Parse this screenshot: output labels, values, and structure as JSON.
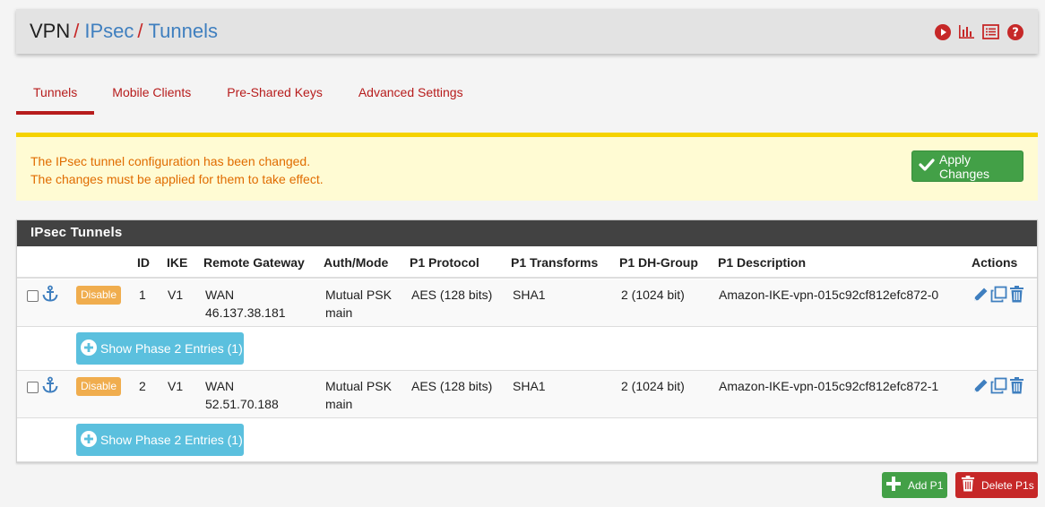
{
  "breadcrumb": {
    "part1": "VPN",
    "sep1": "/",
    "part2": "IPsec",
    "sep2": "/",
    "part3": "Tunnels"
  },
  "header_icons": [
    "play-circle-icon",
    "bar-chart-icon",
    "list-icon",
    "question-circle-icon"
  ],
  "tabs": [
    {
      "label": "Tunnels",
      "active": true
    },
    {
      "label": "Mobile Clients",
      "active": false
    },
    {
      "label": "Pre-Shared Keys",
      "active": false
    },
    {
      "label": "Advanced Settings",
      "active": false
    }
  ],
  "alert": {
    "line1": "The IPsec tunnel configuration has been changed.",
    "line2": "The changes must be applied for them to take effect.",
    "button": "Apply Changes"
  },
  "panel": {
    "title": "IPsec Tunnels",
    "columns": {
      "id": "ID",
      "ike": "IKE",
      "remote_gateway": "Remote Gateway",
      "auth_mode": "Auth/Mode",
      "p1_protocol": "P1 Protocol",
      "p1_transforms": "P1 Transforms",
      "p1_dh_group": "P1 DH-Group",
      "p1_description": "P1 Description",
      "actions": "Actions"
    },
    "tunnels": [
      {
        "disable_label": "Disable",
        "id": "1",
        "ike": "V1",
        "gateway_if": "WAN",
        "gateway_ip": "46.137.38.181",
        "auth": "Mutual PSK",
        "mode": "main",
        "protocol": "AES (128 bits)",
        "transforms": "SHA1",
        "dh_group": "2 (1024 bit)",
        "description": "Amazon-IKE-vpn-015c92cf812efc872-0",
        "phase2_label": "Show Phase 2 Entries (1)"
      },
      {
        "disable_label": "Disable",
        "id": "2",
        "ike": "V1",
        "gateway_if": "WAN",
        "gateway_ip": "52.51.70.188",
        "auth": "Mutual PSK",
        "mode": "main",
        "protocol": "AES (128 bits)",
        "transforms": "SHA1",
        "dh_group": "2 (1024 bit)",
        "description": "Amazon-IKE-vpn-015c92cf812efc872-1",
        "phase2_label": "Show Phase 2 Entries (1)"
      }
    ]
  },
  "footer": {
    "add_label": "Add P1",
    "delete_label": "Delete P1s"
  },
  "colors": {
    "accent_red": "#b71c1c",
    "link_blue": "#3f7fbf",
    "success_green": "#43a047",
    "warning_orange": "#f0ad4e",
    "info_cyan": "#5bc0de",
    "danger_red": "#c62828"
  }
}
